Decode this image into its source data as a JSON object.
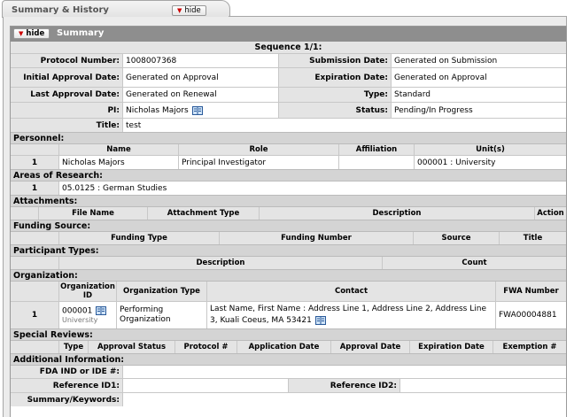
{
  "tab": {
    "title": "Summary & History",
    "hide_label": "hide"
  },
  "summary": {
    "header": "Summary",
    "hide_label": "hide",
    "sequence": "Sequence 1/1:",
    "protocol_number_label": "Protocol Number:",
    "protocol_number": "1008007368",
    "submission_date_label": "Submission Date:",
    "submission_date": "Generated on Submission",
    "initial_approval_label": "Initial Approval Date:",
    "initial_approval": "Generated on Approval",
    "expiration_label": "Expiration Date:",
    "expiration": "Generated on Approval",
    "last_approval_label": "Last Approval Date:",
    "last_approval": "Generated on Renewal",
    "type_label": "Type:",
    "type": "Standard",
    "pi_label": "PI:",
    "pi": "Nicholas Majors",
    "status_label": "Status:",
    "status": "Pending/In Progress",
    "title_label": "Title:",
    "title": "test"
  },
  "personnel": {
    "label": "Personnel:",
    "cols": [
      "Name",
      "Role",
      "Affiliation",
      "Unit(s)"
    ],
    "row": {
      "num": "1",
      "name": "Nicholas Majors",
      "role": "Principal Investigator",
      "affiliation": "",
      "unit": "000001 : University"
    }
  },
  "research": {
    "label": "Areas of Research:",
    "num": "1",
    "value": "05.0125 : German Studies"
  },
  "attachments": {
    "label": "Attachments:",
    "cols": [
      "File Name",
      "Attachment Type",
      "Description",
      "Action"
    ]
  },
  "funding": {
    "label": "Funding Source:",
    "cols": [
      "Funding Type",
      "Funding Number",
      "Source",
      "Title"
    ]
  },
  "participants": {
    "label": "Participant Types:",
    "cols": [
      "Description",
      "Count"
    ]
  },
  "organization": {
    "label": "Organization:",
    "cols": [
      "Organization ID",
      "Organization Type",
      "Contact",
      "FWA Number"
    ],
    "row": {
      "num": "1",
      "id": "000001",
      "id_sub": "University",
      "type": "Performing Organization",
      "contact": "Last Name, First Name : Address Line 1, Address Line 2, Address Line 3, Kuali Coeus, MA 53421",
      "fwa": "FWA00004881"
    }
  },
  "special_reviews": {
    "label": "Special Reviews:",
    "cols": [
      "Type",
      "Approval Status",
      "Protocol #",
      "Application Date",
      "Approval Date",
      "Expiration Date",
      "Exemption #"
    ]
  },
  "additional": {
    "label": "Additional Information:",
    "fda_label": "FDA IND or IDE #:",
    "ref1_label": "Reference ID1:",
    "ref2_label": "Reference ID2:",
    "keywords_label": "Summary/Keywords:"
  }
}
